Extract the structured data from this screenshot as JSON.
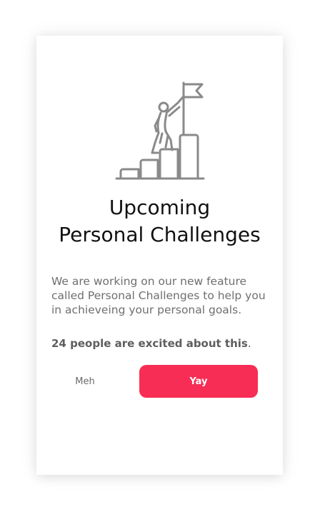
{
  "card": {
    "illustration_icon": "person-climbing-stairs-with-flag-icon",
    "title_line1": "Upcoming",
    "title_line2": "Personal Challenges",
    "description": "We are working on our new feature called Personal Challenges to help you in achieveing your personal goals.",
    "excited_count": "24",
    "excited_text": "people are excited about this",
    "excited_suffix": "."
  },
  "actions": {
    "meh_label": "Meh",
    "yay_label": "Yay"
  },
  "colors": {
    "accent": "#f72d55",
    "icon_stroke": "#8a8a8a",
    "title": "#111111",
    "body_text": "#6f6f6f"
  }
}
